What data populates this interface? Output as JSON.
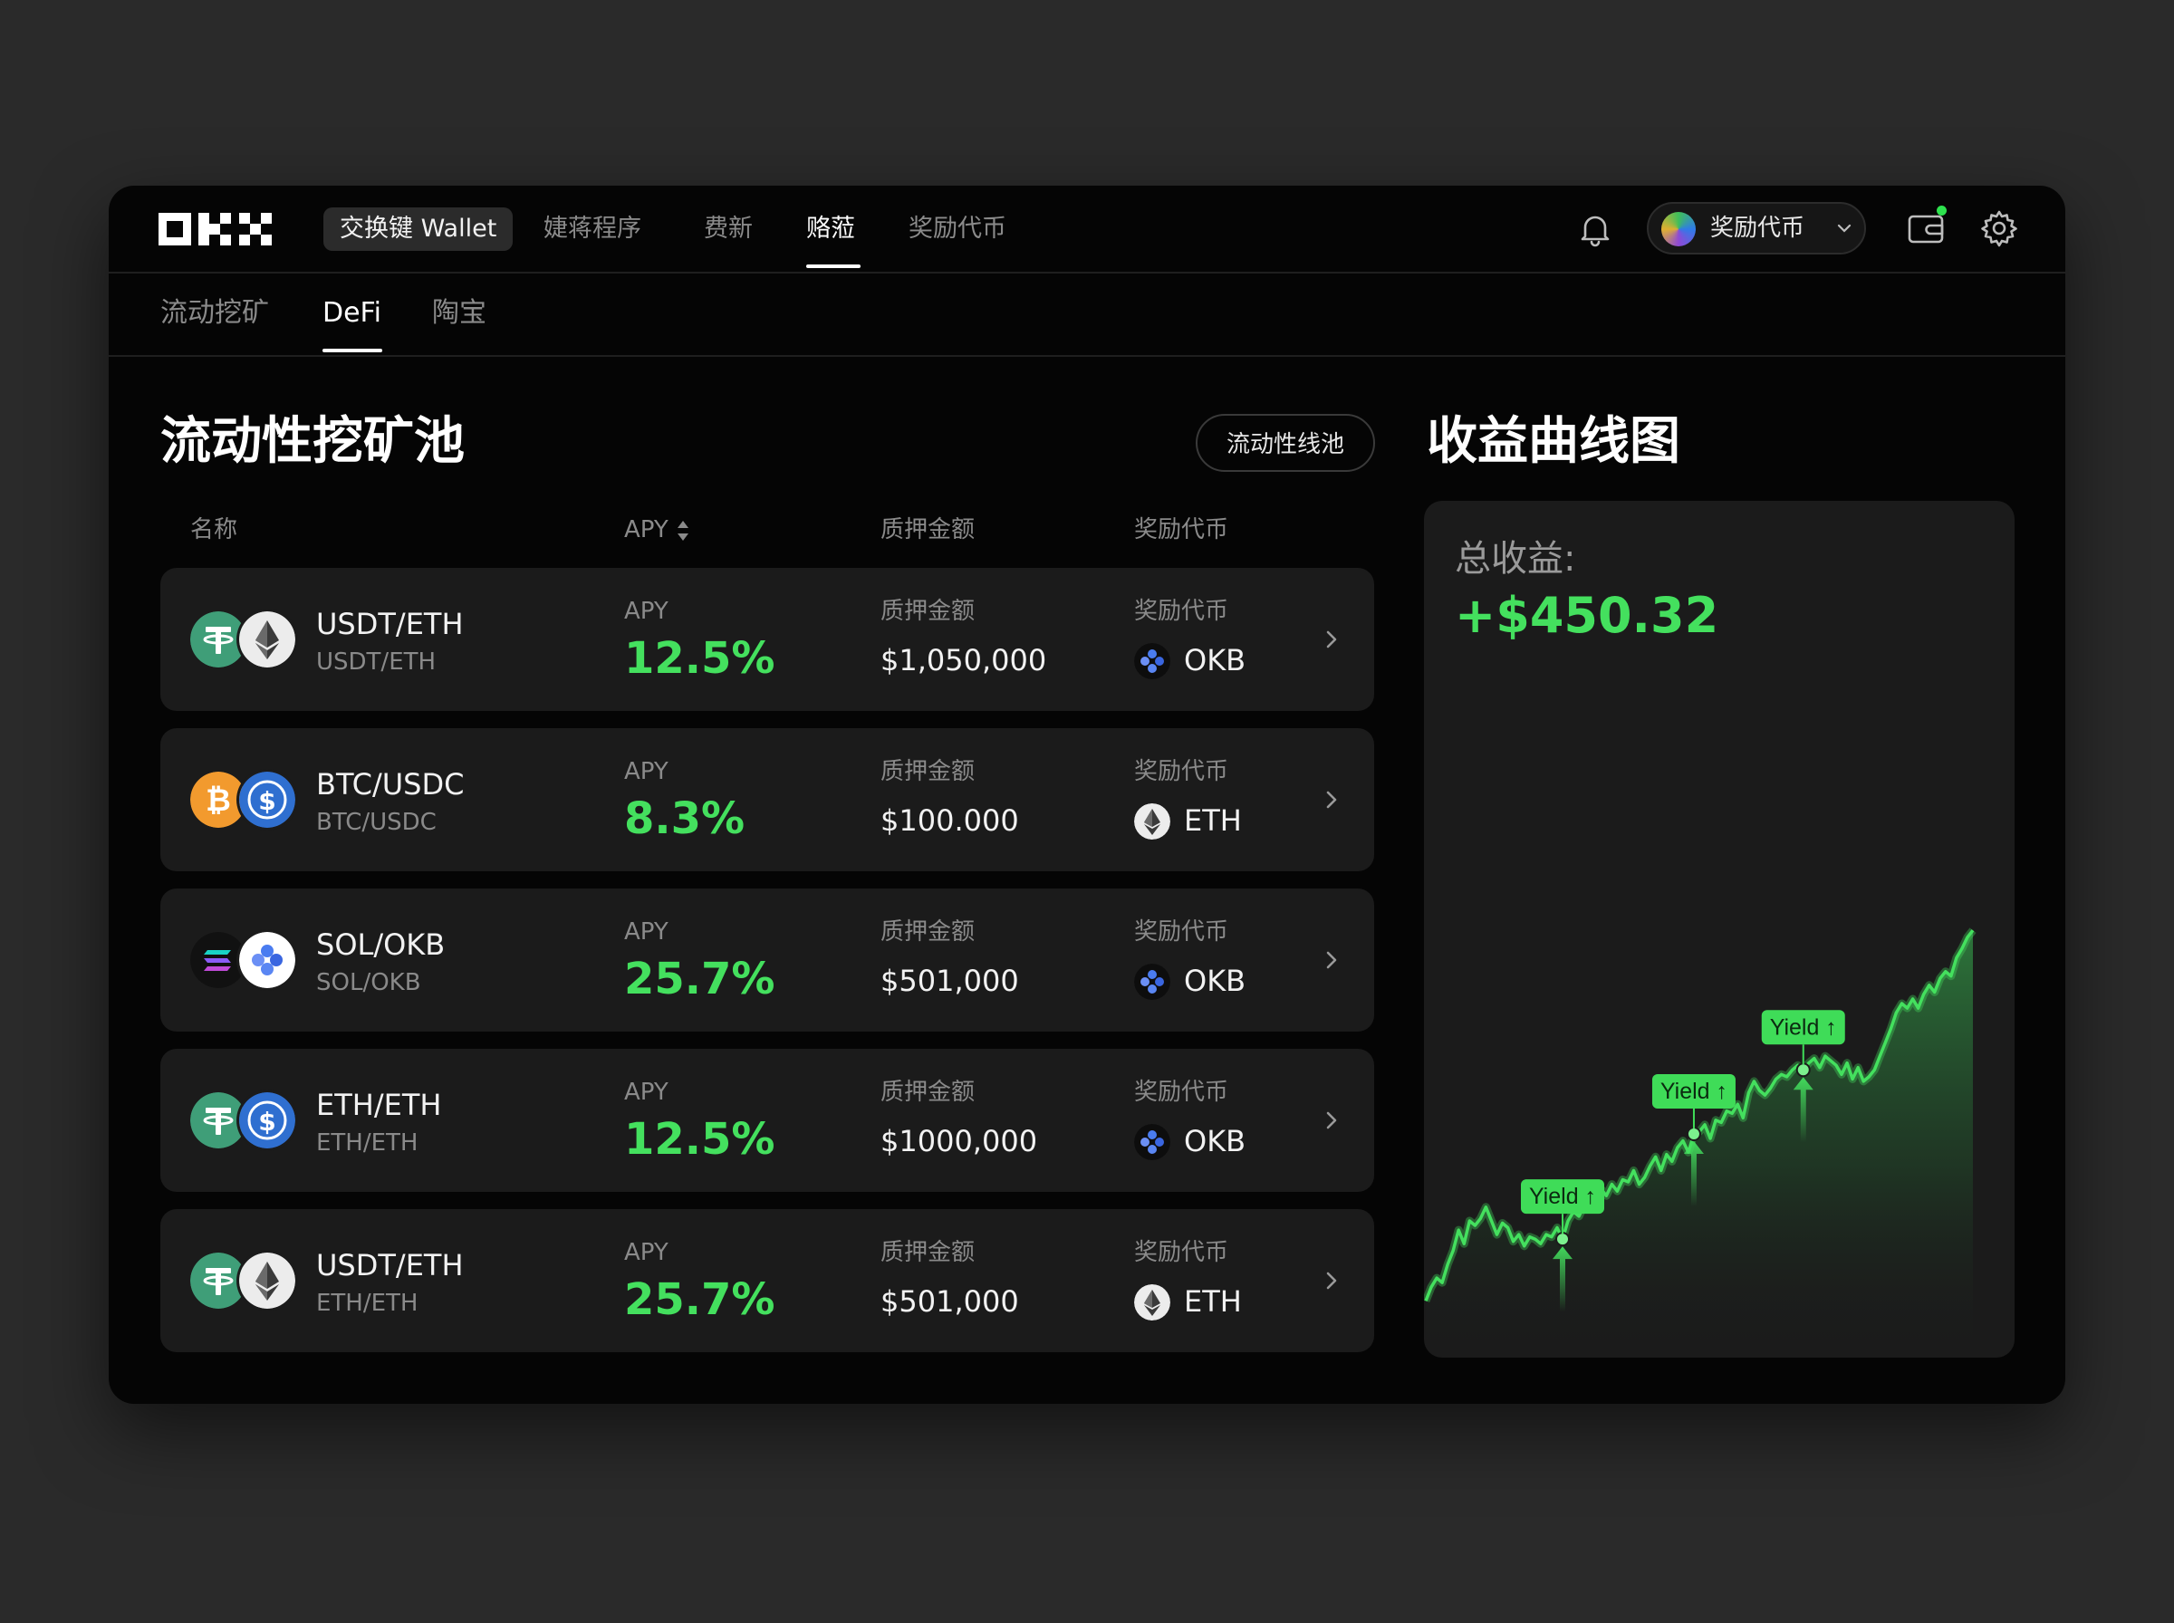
{
  "brand": {
    "logo": "OKX"
  },
  "nav": {
    "items": [
      {
        "label": "交换键 Wallet",
        "style": "pill"
      },
      {
        "label": "婕蒋程序",
        "style": "normal"
      },
      {
        "label": "费新",
        "style": "normal"
      },
      {
        "label": "赂蒞",
        "style": "active"
      },
      {
        "label": "奖励代币",
        "style": "normal"
      }
    ],
    "account_label": "奖励代币"
  },
  "subnav": {
    "items": [
      "流动挖矿",
      "DeFi",
      "陶宝"
    ],
    "active": "DeFi"
  },
  "pools": {
    "title": "流动性挖矿池",
    "action_label": "流动性线池",
    "headers": {
      "name": "名称",
      "apy": "APY",
      "stake": "质押金额",
      "reward": "奖励代币"
    },
    "rows": [
      {
        "pair": "USDT/ETH",
        "pair_sub": "USDT/ETH",
        "tokens": [
          "usdt",
          "eth"
        ],
        "apy_label": "APY",
        "apy": "12.5%",
        "stake_label": "质押金额",
        "stake": "$1,050,000",
        "reward_label": "奖励代币",
        "reward_token": "OKB",
        "reward_icon": "okb"
      },
      {
        "pair": "BTC/USDC",
        "pair_sub": "BTC/USDC",
        "tokens": [
          "btc",
          "usdc"
        ],
        "apy_label": "APY",
        "apy": "8.3%",
        "stake_label": "质押金额",
        "stake": "$100.000",
        "reward_label": "奖励代币",
        "reward_token": "ETH",
        "reward_icon": "eth"
      },
      {
        "pair": "SOL/OKB",
        "pair_sub": "SOL/OKB",
        "tokens": [
          "sol",
          "okb"
        ],
        "apy_label": "APY",
        "apy": "25.7%",
        "stake_label": "质押金额",
        "stake": "$501,000",
        "reward_label": "奖励代币",
        "reward_token": "OKB",
        "reward_icon": "okb"
      },
      {
        "pair": "ETH/ETH",
        "pair_sub": "ETH/ETH",
        "tokens": [
          "usdt",
          "usdc"
        ],
        "apy_label": "APY",
        "apy": "12.5%",
        "stake_label": "质押金额",
        "stake": "$1000,000",
        "reward_label": "奖励代币",
        "reward_token": "OKB",
        "reward_icon": "okb"
      },
      {
        "pair": "USDT/ETH",
        "pair_sub": "ETH/ETH",
        "tokens": [
          "usdt",
          "eth"
        ],
        "apy_label": "APY",
        "apy": "25.7%",
        "stake_label": "质押金额",
        "stake": "$501,000",
        "reward_label": "奖励代币",
        "reward_token": "ETH",
        "reward_icon": "eth"
      }
    ]
  },
  "earnings": {
    "title": "收益曲线图",
    "total_label": "总收益:",
    "total_value": "+$450.32"
  },
  "chart_data": {
    "type": "area",
    "title": "收益曲线图",
    "xlabel": "",
    "ylabel": "",
    "grid": false,
    "legend": "none",
    "line_color": "#44e05e",
    "x": [
      0,
      1,
      2,
      3,
      4,
      5,
      6,
      7,
      8,
      9,
      10,
      11,
      12,
      13,
      14,
      15,
      16,
      17,
      18,
      19,
      20,
      21,
      22,
      23,
      24,
      25,
      26,
      27,
      28,
      29,
      30,
      31,
      32,
      33,
      34,
      35,
      36,
      37,
      38,
      39,
      40,
      41,
      42,
      43,
      44,
      45,
      46,
      47,
      48,
      49,
      50,
      51,
      52,
      53,
      54,
      55,
      56,
      57,
      58,
      59,
      60,
      61,
      62,
      63,
      64,
      65,
      66,
      67,
      68,
      69,
      70,
      71,
      72,
      73,
      74,
      75,
      76,
      77,
      78,
      79,
      80,
      81,
      82,
      83,
      84,
      85,
      86,
      87,
      88,
      89,
      90,
      91,
      92,
      93,
      94,
      95,
      96,
      97,
      98,
      99,
      100
    ],
    "values": [
      5,
      11,
      15,
      13,
      21,
      27,
      36,
      30,
      40,
      38,
      41,
      46,
      40,
      34,
      39,
      37,
      31,
      34,
      29,
      33,
      32,
      30,
      34,
      33,
      37,
      32,
      40,
      44,
      42,
      47,
      51,
      49,
      54,
      51,
      56,
      53,
      58,
      57,
      62,
      56,
      59,
      64,
      68,
      62,
      69,
      66,
      72,
      75,
      70,
      78,
      79,
      82,
      76,
      84,
      83,
      88,
      87,
      91,
      85,
      96,
      101,
      97,
      95,
      98,
      102,
      104,
      103,
      106,
      108,
      106,
      109,
      111,
      107,
      112,
      110,
      108,
      104,
      109,
      102,
      107,
      101,
      103,
      106,
      112,
      118,
      124,
      131,
      135,
      133,
      137,
      133,
      139,
      143,
      140,
      146,
      149,
      147,
      155,
      159,
      164,
      167
    ],
    "ylim": [
      0,
      175
    ],
    "annotations": [
      {
        "label": "Yield ↑",
        "x": 25
      },
      {
        "label": "Yield ↑",
        "x": 49
      },
      {
        "label": "Yield ↑",
        "x": 69
      }
    ]
  }
}
